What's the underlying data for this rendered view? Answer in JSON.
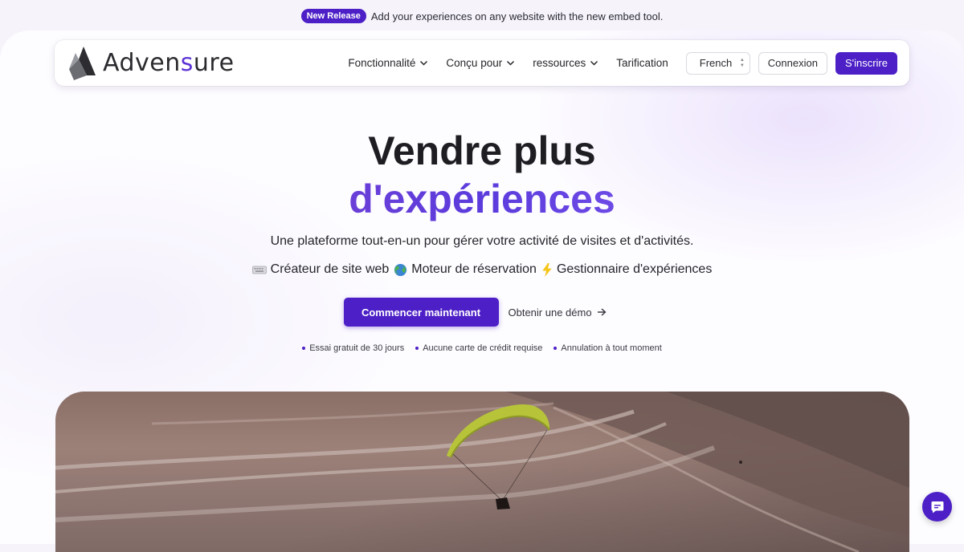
{
  "announcement": {
    "badge": "New Release",
    "text": "Add your experiences on any website with the new embed tool."
  },
  "brand": {
    "name_part1": "Adven",
    "name_accent": "s",
    "name_part2": "ure",
    "accent_color": "#5b33d6",
    "primary_color": "#4c1fc7"
  },
  "nav": {
    "items": [
      {
        "label": "Fonctionnalité",
        "has_dropdown": true
      },
      {
        "label": "Conçu pour",
        "has_dropdown": true
      },
      {
        "label": "ressources",
        "has_dropdown": true
      },
      {
        "label": "Tarification",
        "has_dropdown": false
      }
    ],
    "language": "French",
    "login_label": "Connexion",
    "signup_label": "S'inscrire"
  },
  "hero": {
    "title_line1": "Vendre plus",
    "title_line2": "d'expériences",
    "subtitle": "Une plateforme tout-en-un pour gérer votre activité de visites et d'activités.",
    "features": [
      {
        "icon": "keyboard-icon",
        "label": "Créateur de site web"
      },
      {
        "icon": "globe-icon",
        "label": "Moteur de réservation"
      },
      {
        "icon": "lightning-icon",
        "label": "Gestionnaire d'expériences"
      }
    ],
    "cta_primary": "Commencer maintenant",
    "cta_secondary": "Obtenir une démo",
    "perks": [
      "Essai gratuit de 30 jours",
      "Aucune carte de crédit requise",
      "Annulation à tout moment"
    ]
  }
}
